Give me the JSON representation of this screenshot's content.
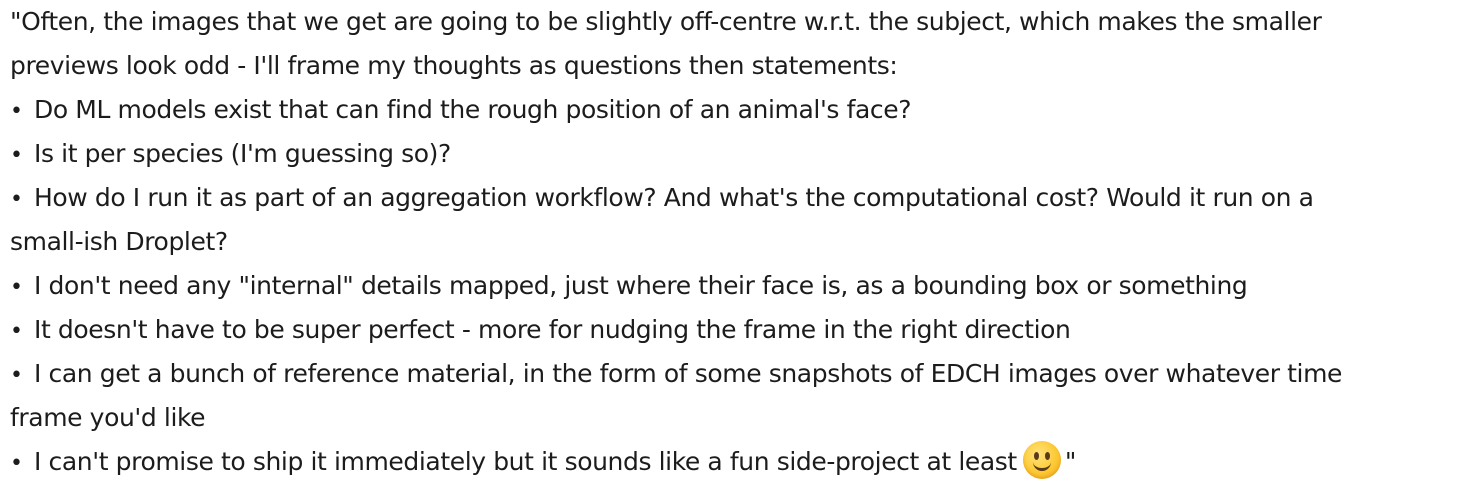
{
  "message": {
    "intro_line1": "\"Often, the images that we get are going to be slightly off-centre w.r.t. the subject, which makes the smaller",
    "intro_line2": "previews look odd - I'll frame my thoughts as questions then statements:",
    "bullet_symbol": "•",
    "bullets": [
      {
        "line1": "Do ML models exist that can find the rough position of an animal's face?"
      },
      {
        "line1": "Is it per species (I'm guessing so)?"
      },
      {
        "line1": "How do I run it as part of an aggregation workflow? And what's the computational cost? Would it run on a",
        "line2": "small-ish Droplet?"
      },
      {
        "line1": "I don't need any \"internal\" details mapped, just where their face is, as a bounding box or something"
      },
      {
        "line1": "It doesn't have to be super perfect - more for nudging the frame in the right direction"
      },
      {
        "line1": "I can get a bunch of reference material, in the form of some snapshots of EDCH images over whatever time",
        "line2": "frame you'd like"
      },
      {
        "line1": "I can't promise to ship it immediately but it sounds like a fun side-project at least"
      }
    ],
    "emoji": "slightly-smiling-face-icon",
    "closing_quote": "\""
  }
}
